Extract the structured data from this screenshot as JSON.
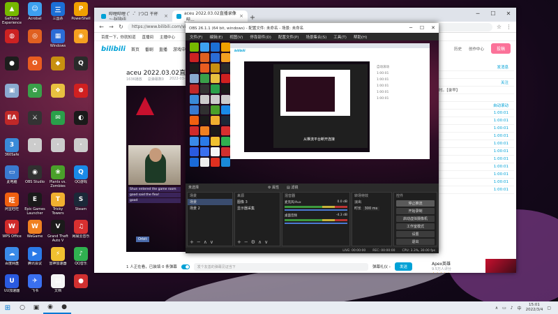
{
  "desktop": {
    "icons": [
      {
        "label": "GeForce Experience",
        "color": "#76b900",
        "glyph": "▲"
      },
      {
        "label": "Acrobat",
        "color": "#3da0f0",
        "glyph": "☺"
      },
      {
        "label": "三国杀",
        "color": "#1c6fd6",
        "glyph": "三"
      },
      {
        "label": "PowerShell",
        "color": "#f0a000",
        "glyph": "P"
      },
      {
        "label": "",
        "color": "#c22",
        "glyph": "◍"
      },
      {
        "label": "",
        "color": "#e06020",
        "glyph": "◎"
      },
      {
        "label": "Windows",
        "color": "#2b6cd6",
        "glyph": "▦"
      },
      {
        "label": "",
        "color": "#f4a020",
        "glyph": "◉"
      },
      {
        "label": "",
        "color": "#1d1d1d",
        "glyph": "●"
      },
      {
        "label": "",
        "color": "#e85c20",
        "glyph": "O"
      },
      {
        "label": "",
        "color": "#c89010",
        "glyph": "◆"
      },
      {
        "label": "",
        "color": "#2a2a2a",
        "glyph": "Q"
      },
      {
        "label": "",
        "color": "#8aaad0",
        "glyph": "▣"
      },
      {
        "label": "",
        "color": "#3aa04a",
        "glyph": "✿"
      },
      {
        "label": "",
        "color": "#e8c040",
        "glyph": "❖"
      },
      {
        "label": "",
        "color": "#d02020",
        "glyph": "⊕"
      },
      {
        "label": "",
        "color": "#c02828",
        "glyph": "EA"
      },
      {
        "label": "",
        "color": "#333",
        "glyph": "⚔"
      },
      {
        "label": "",
        "color": "#2aa04a",
        "glyph": "✉"
      },
      {
        "label": "",
        "color": "#1a1a1a",
        "glyph": "◐"
      },
      {
        "label": "360Safe",
        "color": "#3a8ad8",
        "glyph": "3"
      },
      {
        "label": "",
        "color": "#ccc",
        "glyph": "·"
      },
      {
        "label": "",
        "color": "#ccc",
        "glyph": "·"
      },
      {
        "label": "",
        "color": "#ccc",
        "glyph": "·"
      },
      {
        "label": "此电脑",
        "color": "#3a7ad0",
        "glyph": "▭"
      },
      {
        "label": "OBS Studio",
        "color": "#303030",
        "glyph": "◉"
      },
      {
        "label": "Plants vs. Zombies",
        "color": "#4aa02a",
        "glyph": "❀"
      },
      {
        "label": "QQ游戏",
        "color": "#1a8ae8",
        "glyph": "Q"
      },
      {
        "label": "阿里旺旺",
        "color": "#f06010",
        "glyph": "旺"
      },
      {
        "label": "Epic Games Launcher",
        "color": "#1a1a1a",
        "glyph": "E"
      },
      {
        "label": "Tricky Towers",
        "color": "#f0b030",
        "glyph": "T"
      },
      {
        "label": "Steam",
        "color": "#1b2838",
        "glyph": "S"
      },
      {
        "label": "WPS Office",
        "color": "#d02a2a",
        "glyph": "W"
      },
      {
        "label": "WeGame",
        "color": "#f08020",
        "glyph": "W"
      },
      {
        "label": "Grand Theft Auto V",
        "color": "#1a1a1a",
        "glyph": "V"
      },
      {
        "label": "网易云音乐",
        "color": "#d83030",
        "glyph": "♫"
      },
      {
        "label": "百度网盘",
        "color": "#3a8ae8",
        "glyph": "☁"
      },
      {
        "label": "腾讯会议",
        "color": "#2a7ae8",
        "glyph": "▶"
      },
      {
        "label": "雷神加速器",
        "color": "#f0c030",
        "glyph": "⚡"
      },
      {
        "label": "QQ音乐",
        "color": "#30b050",
        "glyph": "♪"
      },
      {
        "label": "UU加速器",
        "color": "#2a5ae0",
        "glyph": "U"
      },
      {
        "label": "飞书",
        "color": "#3a70f0",
        "glyph": "✈"
      },
      {
        "label": "文档",
        "color": "#f5f5f5",
        "glyph": "▤"
      },
      {
        "label": "",
        "color": "#d03030",
        "glyph": "●"
      },
      {
        "label": "腾讯会议助手",
        "color": "#1a6ad8",
        "glyph": "◔"
      },
      {
        "label": "Google Chrome",
        "color": "#eee",
        "glyph": "◉"
      },
      {
        "label": "网易UU",
        "color": "#e03020",
        "glyph": "U"
      },
      {
        "label": "网易有道词典",
        "color": "#1a8ad8",
        "glyph": "◎"
      }
    ]
  },
  "browser": {
    "tabs": [
      {
        "label": "哔哩哔哩 (゜-゜)つロ 干杯~-bilibili"
      },
      {
        "label": "aceu 2022.03.02直播录像_哔..."
      }
    ],
    "url": "https://www.bilibili.com/video/BV1xxx?share_source=copy_web",
    "bookmarks": [
      "百度一下，你就知道",
      "直播间",
      "主播中心"
    ],
    "header": {
      "logo": "bilibili",
      "nav": [
        "首页",
        "番剧",
        "直播",
        "游戏中心"
      ],
      "right": [
        "历史",
        "创作中心"
      ],
      "upload": "投稿"
    },
    "video": {
      "title": "aceu 2022.03.02直播录像",
      "meta": [
        "1636播放",
        "总弹幕数0",
        "2022-03-02"
      ]
    },
    "sidebar": {
      "lines": [
        {
          "a": "",
          "b": "发消息"
        },
        {
          "a": "",
          "b": ""
        },
        {
          "a": "",
          "b": "关注"
        },
        {
          "a": "直播一小时。【录早】",
          "b": ""
        },
        {
          "a": "弹幕列表",
          "b": ""
        },
        {
          "a": "",
          "b": "自动滚动"
        },
        {
          "a": "",
          "b": "1:00:01"
        },
        {
          "a": "",
          "b": "1:00:01"
        },
        {
          "a": "",
          "b": "1:00:01"
        },
        {
          "a": "",
          "b": "1:00:01"
        },
        {
          "a": "",
          "b": "1:00:01"
        },
        {
          "a": "",
          "b": "1:00:01"
        },
        {
          "a": "",
          "b": "1:00:01"
        },
        {
          "a": "",
          "b": "1:00:01"
        },
        {
          "a": "",
          "b": "1:00:01"
        },
        {
          "a": "",
          "b": "1:00:01"
        },
        {
          "a": "",
          "b": "1:00:01"
        }
      ]
    },
    "danmu": {
      "count": "1 人正在看，已装填 0 条弹幕",
      "placeholder": "发个友善的弹幕见证当下",
      "etiquette": "弹幕礼仪 ›",
      "send": "发送"
    },
    "ad": {
      "title": "Apex英雄",
      "sub": "9.5万人评分",
      "rating": "★★★★☆"
    },
    "player": {
      "chat": [
        "Shun entered the game room",
        "good said the flea!",
        "good",
        ""
      ],
      "tag": "Orbit"
    }
  },
  "obs": {
    "title": "OBS 26.1.1 (64 bit, windows) - 配置文件: 未命名 - 场景: 未命名",
    "menu": [
      "文件(F)",
      "编辑(E)",
      "视图(V)",
      "停靠部件(D)",
      "配置文件(P)",
      "场景集合(S)",
      "工具(T)",
      "帮助(H)"
    ],
    "preview_msg": "从推流平台断开连接",
    "nested_side": [
      "",
      "自动滚动",
      "1:00:01",
      "1:00:01",
      "1:00:01",
      "1:00:01",
      "1:00:01"
    ],
    "docks": {
      "scenes": {
        "title": "场景",
        "items": [
          "场景",
          "场景 2"
        ]
      },
      "sources": {
        "title": "来源",
        "items": [
          "图像 3",
          "显示器采集"
        ]
      },
      "mixer": {
        "title": "混音器",
        "rows": [
          {
            "name": "麦克风/Aux",
            "db": "0.0 dB"
          },
          {
            "name": "桌面音频",
            "db": "-4.3 dB"
          }
        ]
      },
      "transitions": {
        "title": "转场特效",
        "fade": "淡出",
        "duration_label": "时长",
        "duration": "300 ms"
      },
      "controls": {
        "title": "控件",
        "buttons": [
          "停止推流",
          "开始录制",
          "启动虚拟摄像机",
          "工作室模式",
          "设置",
          "退出"
        ]
      }
    },
    "status": [
      "LIVE: 00:00:00",
      "REC: 00:00:00",
      "CPU: 3.3%, 30.00 fps"
    ],
    "audio_label": "未选择"
  },
  "taskbar": {
    "items": [
      "⊞",
      "○",
      "▣",
      "◉",
      "◆"
    ],
    "time": "15:01",
    "date": "2022/3/4",
    "ime": "中"
  }
}
